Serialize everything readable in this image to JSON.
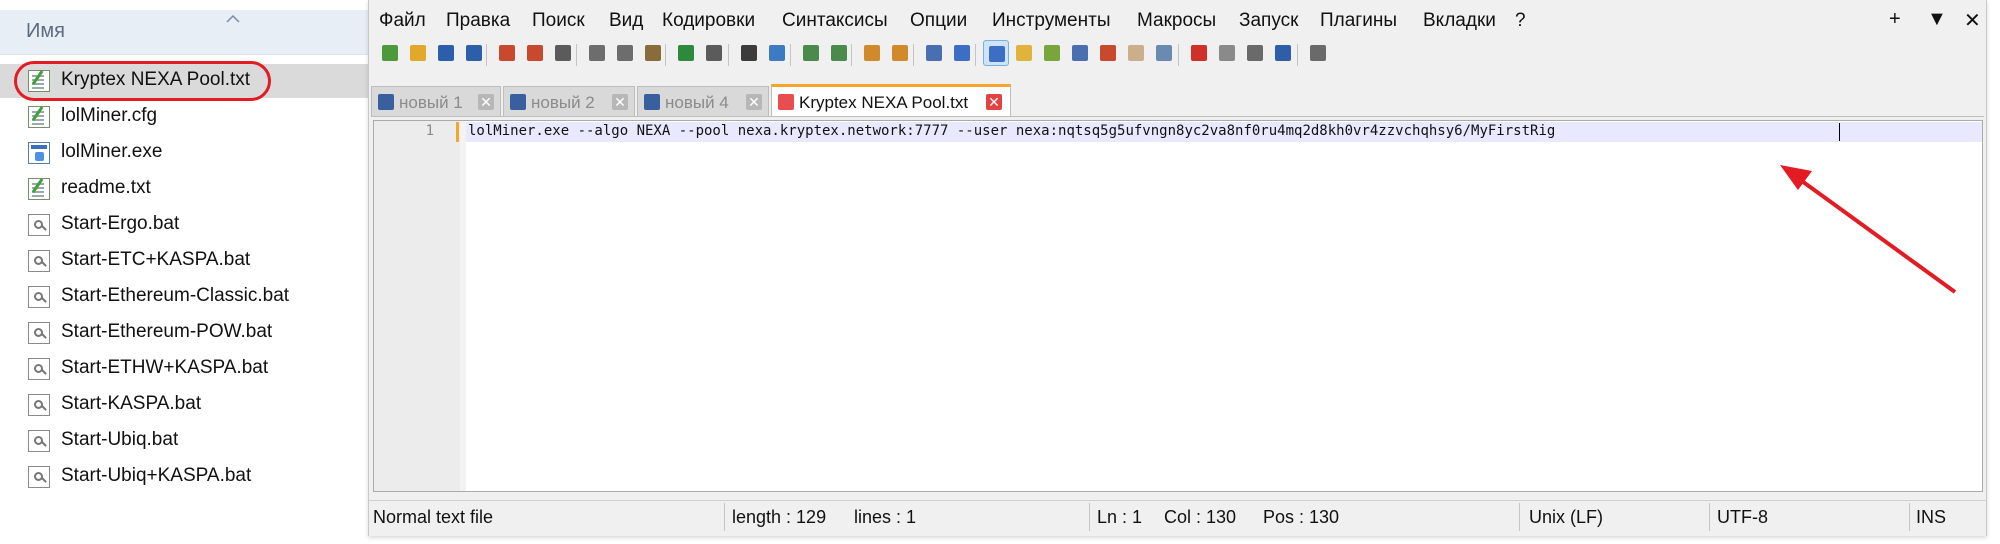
{
  "explorer": {
    "column_header": "Имя",
    "files": [
      {
        "name": "Kryptex NEXA Pool.txt",
        "icon": "text-file-icon"
      },
      {
        "name": "lolMiner.cfg",
        "icon": "text-file-icon"
      },
      {
        "name": "lolMiner.exe",
        "icon": "exe-file-icon"
      },
      {
        "name": "readme.txt",
        "icon": "text-file-icon"
      },
      {
        "name": "Start-Ergo.bat",
        "icon": "batch-file-icon"
      },
      {
        "name": "Start-ETC+KASPA.bat",
        "icon": "batch-file-icon"
      },
      {
        "name": "Start-Ethereum-Classic.bat",
        "icon": "batch-file-icon"
      },
      {
        "name": "Start-Ethereum-POW.bat",
        "icon": "batch-file-icon"
      },
      {
        "name": "Start-ETHW+KASPA.bat",
        "icon": "batch-file-icon"
      },
      {
        "name": "Start-KASPA.bat",
        "icon": "batch-file-icon"
      },
      {
        "name": "Start-Ubiq.bat",
        "icon": "batch-file-icon"
      },
      {
        "name": "Start-Ubiq+KASPA.bat",
        "icon": "batch-file-icon"
      }
    ],
    "highlight_color": "#e31b23"
  },
  "menu": {
    "items": [
      "Файл",
      "Правка",
      "Поиск",
      "Вид",
      "Кодировки",
      "Синтаксисы",
      "Опции",
      "Инструменты",
      "Макросы",
      "Запуск",
      "Плагины",
      "Вкладки",
      "?"
    ],
    "window_controls": [
      "+",
      "▼",
      "✕"
    ]
  },
  "tabs": [
    {
      "label": "новый 1",
      "close": "✕"
    },
    {
      "label": "новый 2",
      "close": "✕"
    },
    {
      "label": "новый 4",
      "close": "✕"
    },
    {
      "label": "Kryptex NEXA Pool.txt",
      "close": "✕"
    }
  ],
  "editor": {
    "line_number": "1",
    "line_text": "lolMiner.exe --algo NEXA --pool nexa.kryptex.network:7777 --user nexa:nqtsq5g5ufvngn8yc2va8nf0ru4mq2d8kh0vr4zzvchqhsy6/MyFirstRig"
  },
  "status": {
    "file_type": "Normal text file",
    "length": "length : 129",
    "lines": "lines : 1",
    "ln": "Ln : 1",
    "col": "Col : 130",
    "pos": "Pos : 130",
    "eol": "Unix (LF)",
    "encoding": "UTF-8",
    "mode": "INS"
  },
  "toolbar_icons": [
    "new-file-icon",
    "open-file-icon",
    "save-icon",
    "save-all-icon",
    "close-icon",
    "close-all-icon",
    "print-icon",
    "cut-icon",
    "copy-icon",
    "paste-icon",
    "undo-icon",
    "redo-icon",
    "find-icon",
    "replace-icon",
    "zoom-in-icon",
    "zoom-out-icon",
    "sync-vertical-icon",
    "sync-horizontal-icon",
    "word-wrap-icon",
    "show-all-chars-icon",
    "indent-guide-icon",
    "udl-icon",
    "doc-map-icon",
    "doc-list-icon",
    "function-list-icon",
    "folder-workspace-icon",
    "monitoring-icon",
    "record-macro-icon",
    "stop-macro-icon",
    "play-macro-icon",
    "run-macro-multiple-icon",
    "save-macro-icon"
  ],
  "colors": {
    "accent_tab": "#f4a52d",
    "close_active": "#e14343",
    "arrow": "#e31b23"
  }
}
